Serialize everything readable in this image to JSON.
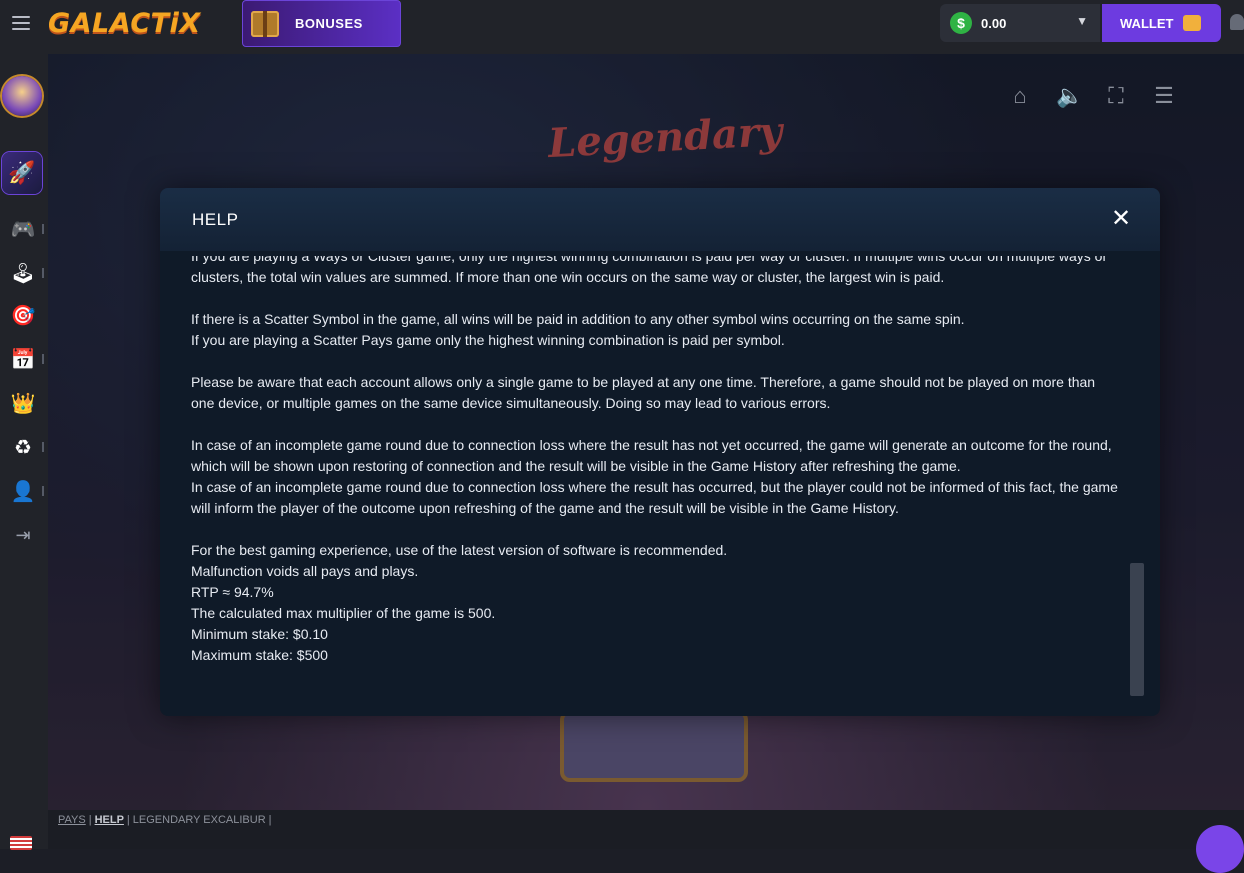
{
  "brand": {
    "logo_text": "GALACTiX"
  },
  "header": {
    "bonuses_label": "BONUSES",
    "balance": "0.00",
    "wallet_label": "WALLET"
  },
  "sidebar": {
    "items": [
      {
        "icon": "astronaut-avatar-icon"
      },
      {
        "icon": "rocket-icon"
      },
      {
        "icon": "gamepad-icon"
      },
      {
        "icon": "joystick-icon"
      },
      {
        "icon": "target-icon"
      },
      {
        "icon": "calendar-icon"
      },
      {
        "icon": "crown-icon"
      },
      {
        "icon": "refer-icon"
      },
      {
        "icon": "user-icon"
      },
      {
        "icon": "logout-icon"
      }
    ]
  },
  "game": {
    "title_art": "Legendary"
  },
  "help": {
    "title": "HELP",
    "close_label": "✕",
    "paragraphs": [
      [
        "If you are playing a Ways or Cluster game, only the highest winning combination is paid per way or cluster. If multiple wins occur on multiple ways or clusters, the total win values are summed. If more than one win occurs on the same way or cluster, the largest win is paid."
      ],
      [
        "If there is a Scatter Symbol in the game, all wins will be paid in addition to any other symbol wins occurring on the same spin.",
        "If you are playing a Scatter Pays game only the highest winning combination is paid per symbol."
      ],
      [
        "Please be aware that each account allows only a single game to be played at any one time. Therefore, a game should not be played on more than one device, or multiple games on the same device simultaneously. Doing so may lead to various errors."
      ],
      [
        "In case of an incomplete game round due to connection loss where the result has not yet occurred, the game will generate an outcome for the round, which will be shown upon restoring of connection and the result will be visible in the Game History after refreshing the game.",
        "In case of an incomplete game round due to connection loss where the result has occurred, but the player could not be informed of this fact, the game will inform the player of the outcome upon refreshing of the game and the result will be visible in the Game History."
      ],
      [
        "For the best gaming experience, use of the latest version of software is recommended.",
        "Malfunction voids all pays and plays.",
        "RTP ≈ 94.7%",
        "The calculated max multiplier of the game is 500.",
        "Minimum stake: $0.10",
        "Maximum stake: $500"
      ]
    ]
  },
  "footer": {
    "pays": "PAYS",
    "help": "HELP",
    "game_name": "LEGENDARY EXCALIBUR"
  }
}
